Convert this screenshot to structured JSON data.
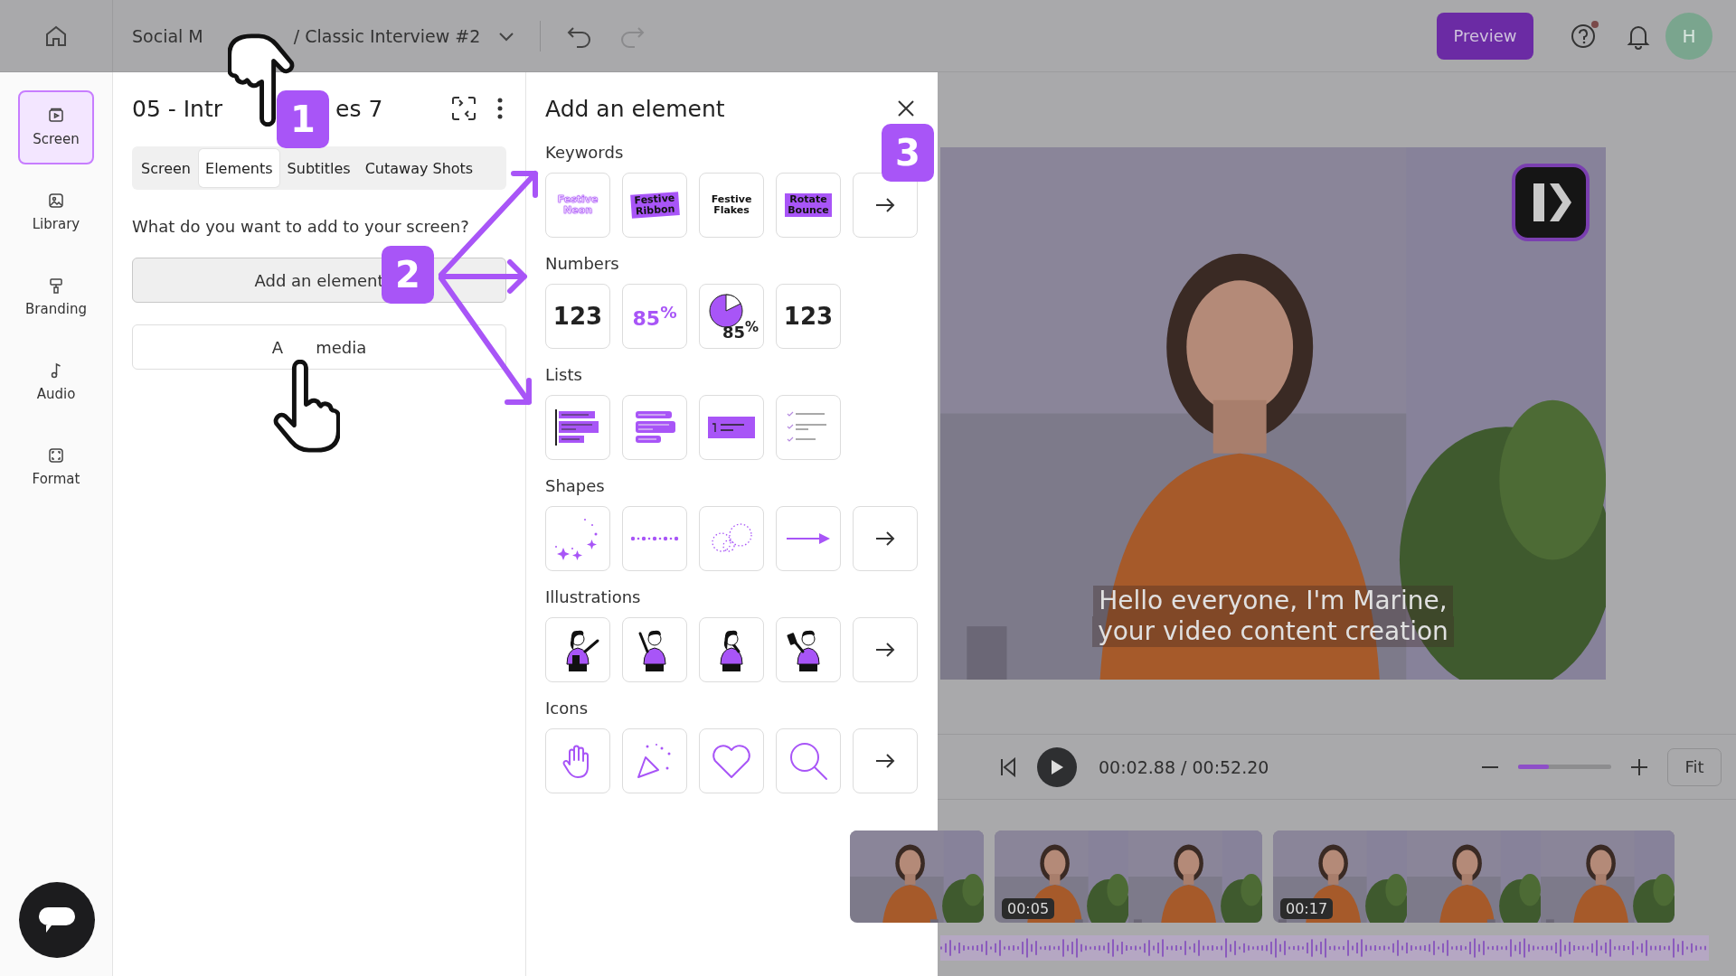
{
  "topbar": {
    "breadcrumb_parts": [
      "Social M",
      "/ Classic Interview #2"
    ],
    "preview_button": "Preview",
    "help_notification": true,
    "avatar": "H"
  },
  "sidebar": {
    "items": [
      {
        "kind": "screen",
        "label": "Screen",
        "selected": true
      },
      {
        "kind": "library",
        "label": "Library",
        "selected": false
      },
      {
        "kind": "branding",
        "label": "Branding",
        "selected": false
      },
      {
        "kind": "audio",
        "label": "Audio",
        "selected": false
      },
      {
        "kind": "format",
        "label": "Format",
        "selected": false
      }
    ]
  },
  "scene_panel": {
    "title_parts": [
      "05 - Intr",
      "es 7"
    ],
    "tabs": [
      {
        "label": "Screen",
        "selected": false
      },
      {
        "label": "Elements",
        "selected": true
      },
      {
        "label": "Subtitles",
        "selected": false
      },
      {
        "label": "Cutaway Shots",
        "selected": false
      }
    ],
    "prompt": "What do you want to add to your screen?",
    "buttons": [
      {
        "kind": "filled",
        "parts": [
          "Add an element"
        ]
      },
      {
        "kind": "outline",
        "parts": [
          "A",
          "media"
        ]
      }
    ]
  },
  "element_panel": {
    "title": "Add an element",
    "sections": [
      {
        "title": "Keywords",
        "more": true,
        "items": [
          {
            "kind": "neon",
            "lines": [
              "Festive",
              "Neon"
            ]
          },
          {
            "kind": "ribbon",
            "lines": [
              "Festive",
              "Ribbon"
            ]
          },
          {
            "kind": "flakes",
            "lines": [
              "Festive",
              "Flakes"
            ]
          },
          {
            "kind": "bounce",
            "lines": [
              "Rotate",
              "Bounce"
            ]
          }
        ]
      },
      {
        "title": "Numbers",
        "items": [
          {
            "kind": "plain",
            "text": "123"
          },
          {
            "kind": "percent",
            "text": "85$^{%}$"
          },
          {
            "kind": "pie",
            "text": "85$^{%}$"
          },
          {
            "kind": "plain",
            "text": "123"
          }
        ]
      },
      {
        "title": "Lists",
        "items": [
          {
            "kind": "bars"
          },
          {
            "kind": "pills"
          },
          {
            "kind": "numbered"
          },
          {
            "kind": "checks"
          }
        ]
      },
      {
        "title": "Shapes",
        "more": true,
        "items": [
          {
            "kind": "sparkles"
          },
          {
            "kind": "dots"
          },
          {
            "kind": "circles"
          },
          {
            "kind": "arrow"
          }
        ]
      },
      {
        "title": "Illustrations",
        "more": true,
        "items": [
          {
            "kind": "woman-tablet"
          },
          {
            "kind": "man-pointing"
          },
          {
            "kind": "woman-thinking"
          },
          {
            "kind": "man-phone"
          }
        ]
      },
      {
        "title": "Icons",
        "more": true,
        "items": [
          {
            "kind": "hand"
          },
          {
            "kind": "party"
          },
          {
            "kind": "heart"
          },
          {
            "kind": "search"
          }
        ]
      }
    ]
  },
  "preview": {
    "subtitle_lines": [
      "Hello everyone, I'm Marine,",
      "your video content creation"
    ]
  },
  "player": {
    "time": "00:02.88 / 00:52.20",
    "zoom": {
      "level": 0.33
    },
    "fit_button": "Fit"
  },
  "timeline": {
    "clips": [
      {
        "time": "00:05"
      },
      {
        "time": "00:17"
      }
    ]
  },
  "tutorial": {
    "badges": [
      "1",
      "2",
      "3"
    ]
  }
}
